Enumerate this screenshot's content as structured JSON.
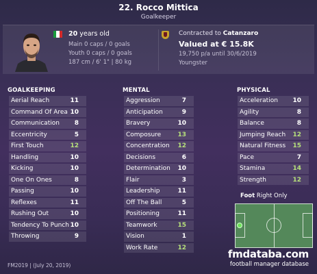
{
  "player": {
    "name": "22. Rocco Mittica",
    "position": "Goalkeeper"
  },
  "info": {
    "age_value": "20",
    "age_suffix": "years old",
    "main_caps": "Main 0 caps / 0 goals",
    "youth_caps": "Youth 0 caps / 0 goals",
    "physique": "187 cm / 6' 1\" | 80 kg",
    "nationality_flag": "italy-flag-icon",
    "contract_prefix": "Contracted to",
    "club": "Catanzaro",
    "value": "Valued at € 15.8K",
    "wage": "19,750 p/a until 30/6/2019",
    "status": "Youngster"
  },
  "sections": {
    "goalkeeping": "GOALKEEPING",
    "mental": "MENTAL",
    "physical": "PHYSICAL"
  },
  "goalkeeping": [
    {
      "label": "Aerial Reach",
      "value": "11",
      "color": "white"
    },
    {
      "label": "Command Of Area",
      "value": "10",
      "color": "white"
    },
    {
      "label": "Communication",
      "value": "8",
      "color": "white"
    },
    {
      "label": "Eccentricity",
      "value": "5",
      "color": "white"
    },
    {
      "label": "First Touch",
      "value": "12",
      "color": "green"
    },
    {
      "label": "Handling",
      "value": "10",
      "color": "white"
    },
    {
      "label": "Kicking",
      "value": "10",
      "color": "white"
    },
    {
      "label": "One On Ones",
      "value": "8",
      "color": "white"
    },
    {
      "label": "Passing",
      "value": "10",
      "color": "white"
    },
    {
      "label": "Reflexes",
      "value": "11",
      "color": "white"
    },
    {
      "label": "Rushing Out",
      "value": "10",
      "color": "white"
    },
    {
      "label": "Tendency To Punch",
      "value": "10",
      "color": "white"
    },
    {
      "label": "Throwing",
      "value": "9",
      "color": "white"
    }
  ],
  "mental": [
    {
      "label": "Aggression",
      "value": "7",
      "color": "white"
    },
    {
      "label": "Anticipation",
      "value": "9",
      "color": "white"
    },
    {
      "label": "Bravery",
      "value": "10",
      "color": "white"
    },
    {
      "label": "Composure",
      "value": "13",
      "color": "green"
    },
    {
      "label": "Concentration",
      "value": "12",
      "color": "green"
    },
    {
      "label": "Decisions",
      "value": "6",
      "color": "white"
    },
    {
      "label": "Determination",
      "value": "10",
      "color": "white"
    },
    {
      "label": "Flair",
      "value": "3",
      "color": "white"
    },
    {
      "label": "Leadership",
      "value": "11",
      "color": "white"
    },
    {
      "label": "Off The Ball",
      "value": "5",
      "color": "white"
    },
    {
      "label": "Positioning",
      "value": "11",
      "color": "white"
    },
    {
      "label": "Teamwork",
      "value": "15",
      "color": "green"
    },
    {
      "label": "Vision",
      "value": "1",
      "color": "white"
    },
    {
      "label": "Work Rate",
      "value": "12",
      "color": "green"
    }
  ],
  "physical": [
    {
      "label": "Acceleration",
      "value": "10",
      "color": "white"
    },
    {
      "label": "Agility",
      "value": "8",
      "color": "white"
    },
    {
      "label": "Balance",
      "value": "8",
      "color": "white"
    },
    {
      "label": "Jumping Reach",
      "value": "12",
      "color": "green"
    },
    {
      "label": "Natural Fitness",
      "value": "15",
      "color": "green"
    },
    {
      "label": "Pace",
      "value": "7",
      "color": "white"
    },
    {
      "label": "Stamina",
      "value": "14",
      "color": "green"
    },
    {
      "label": "Strength",
      "value": "12",
      "color": "green"
    }
  ],
  "foot": {
    "label": "Foot",
    "value": "Right Only"
  },
  "footer": {
    "version": "FM2019 | (July 20, 2019)",
    "site": "fmdataba.com",
    "tagline": "football manager database"
  },
  "colors": {
    "background": "#3a2f56",
    "attribute_good": "#b6e07a",
    "attribute_normal": "#ffffff",
    "pitch": "#54885a"
  }
}
